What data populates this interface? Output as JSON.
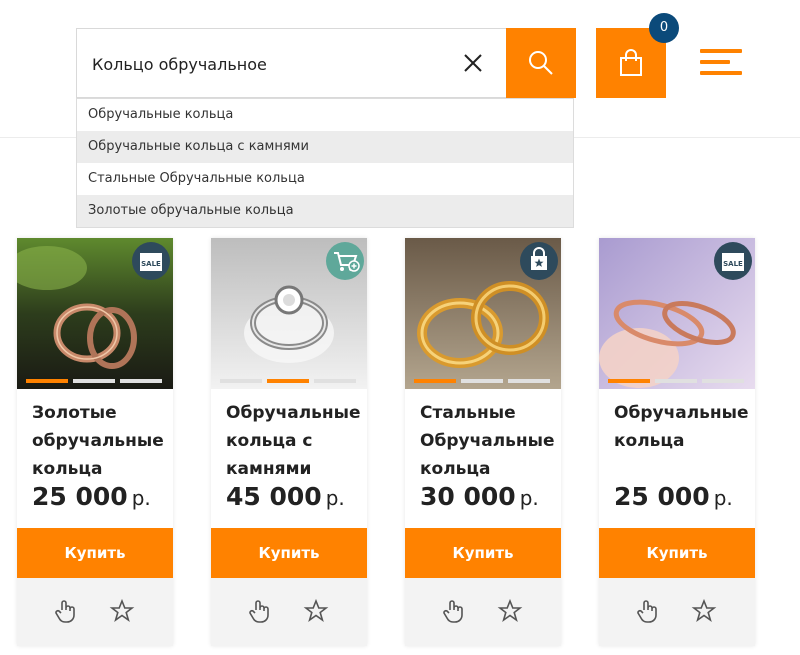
{
  "search": {
    "value": "Кольцо обручальное"
  },
  "cart": {
    "count": "0"
  },
  "suggestions": [
    "Обручальные кольца",
    "Обручальные кольца с камнями",
    "Стальные Обручальные кольца",
    "Золотые обручальные кольца"
  ],
  "products": [
    {
      "title": "Золотые обручальные кольца",
      "price": "25 000",
      "currency": "р.",
      "buy_label": "Купить",
      "badge": "sale-icon",
      "badge_text": "SALE"
    },
    {
      "title": "Обручальные кольца с камнями",
      "price": "45 000",
      "currency": "р.",
      "buy_label": "Купить",
      "badge": "cart-plus-icon"
    },
    {
      "title": "Стальные Обручальные кольца",
      "price": "30 000",
      "currency": "р.",
      "buy_label": "Купить",
      "badge": "star-bag-icon"
    },
    {
      "title": "Обручальные кольца",
      "price": "25 000",
      "currency": "р.",
      "buy_label": "Купить",
      "badge": "sale-icon",
      "badge_text": "SALE"
    }
  ],
  "colors": {
    "accent": "#ff8200",
    "cart_badge": "#0b4a7a",
    "badge_dark": "#2e4a5c",
    "badge_teal": "#5fa89a"
  }
}
